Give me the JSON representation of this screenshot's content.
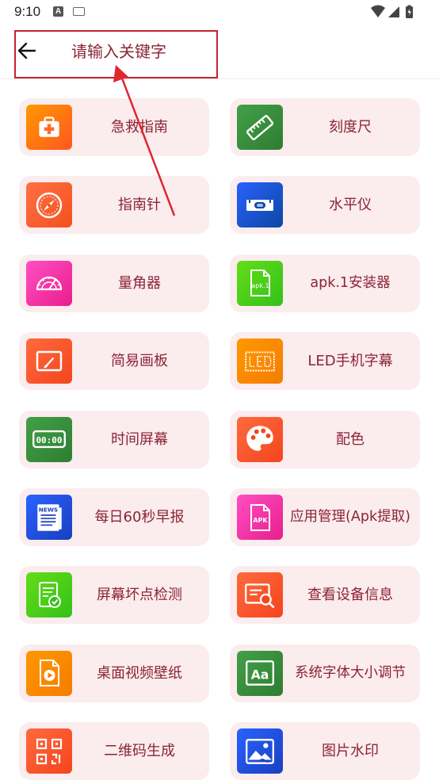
{
  "status_bar": {
    "time": "9:10",
    "notification_badge": "A"
  },
  "search": {
    "placeholder": "请输入关键字"
  },
  "tools": [
    {
      "label": "急救指南",
      "icon": "first-aid-kit-icon",
      "color_from": "#ff9800",
      "color_to": "#ff5722"
    },
    {
      "label": "刻度尺",
      "icon": "ruler-icon",
      "color_from": "#43a047",
      "color_to": "#2e7d32"
    },
    {
      "label": "指南针",
      "icon": "compass-icon",
      "color_from": "#ff7043",
      "color_to": "#f4511e"
    },
    {
      "label": "水平仪",
      "icon": "spirit-level-icon",
      "color_from": "#2962ff",
      "color_to": "#0d47a1"
    },
    {
      "label": "量角器",
      "icon": "protractor-icon",
      "color_from": "#ff4fc3",
      "color_to": "#e91e8c"
    },
    {
      "label": "apk.1安装器",
      "icon": "apk-file-icon",
      "color_from": "#64dd17",
      "color_to": "#33c11a"
    },
    {
      "label": "简易画板",
      "icon": "drawing-board-icon",
      "color_from": "#ff6a3d",
      "color_to": "#f4451e"
    },
    {
      "label": "LED手机字幕",
      "icon": "led-display-icon",
      "color_from": "#ff9800",
      "color_to": "#f57c00"
    },
    {
      "label": "时间屏幕",
      "icon": "digital-clock-icon",
      "color_from": "#43a047",
      "color_to": "#2e7d32"
    },
    {
      "label": "配色",
      "icon": "color-palette-icon",
      "color_from": "#ff6a3d",
      "color_to": "#f4451e"
    },
    {
      "label": "每日60秒早报",
      "icon": "newspaper-icon",
      "color_from": "#2962ff",
      "color_to": "#1a3fbf"
    },
    {
      "label": "应用管理(Apk提取)",
      "icon": "apk-manager-icon",
      "color_from": "#ff4fc3",
      "color_to": "#e91e8c"
    },
    {
      "label": "屏幕坏点检测",
      "icon": "screen-check-icon",
      "color_from": "#64dd17",
      "color_to": "#33c11a"
    },
    {
      "label": "查看设备信息",
      "icon": "device-info-icon",
      "color_from": "#ff6a3d",
      "color_to": "#f4451e"
    },
    {
      "label": "桌面视频壁纸",
      "icon": "video-file-icon",
      "color_from": "#ff9800",
      "color_to": "#f57c00"
    },
    {
      "label": "系统字体大小调节",
      "icon": "font-size-icon",
      "color_from": "#43a047",
      "color_to": "#2e7d32"
    },
    {
      "label": "二维码生成",
      "icon": "qr-code-icon",
      "color_from": "#ff6a3d",
      "color_to": "#f4451e"
    },
    {
      "label": "图片水印",
      "icon": "image-watermark-icon",
      "color_from": "#2962ff",
      "color_to": "#1a3fbf"
    }
  ]
}
